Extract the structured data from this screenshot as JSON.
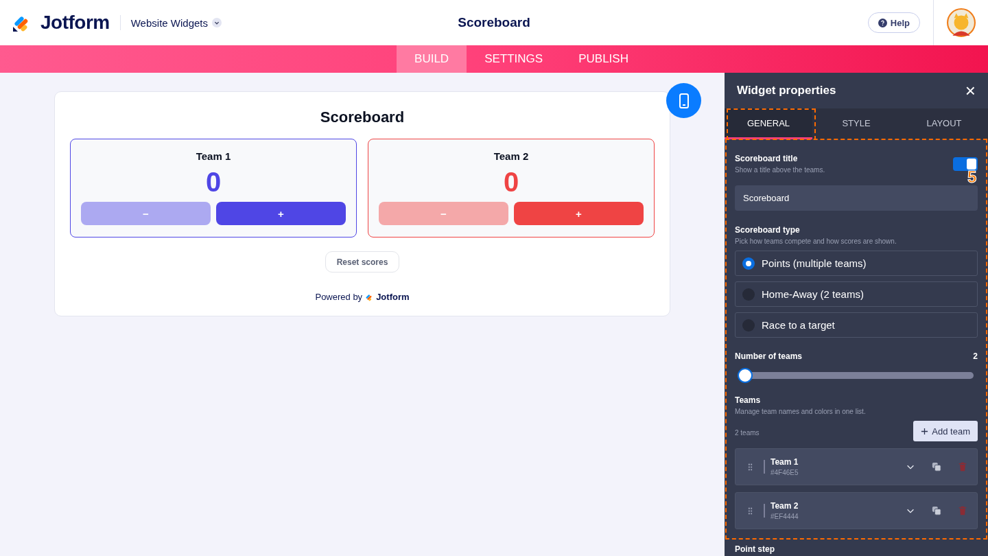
{
  "header": {
    "brand": "Jotform",
    "product": "Website Widgets",
    "title": "Scoreboard",
    "help": "Help"
  },
  "nav_tabs": [
    {
      "label": "BUILD",
      "selected": true
    },
    {
      "label": "SETTINGS",
      "selected": false
    },
    {
      "label": "PUBLISH",
      "selected": false
    }
  ],
  "scoreboard": {
    "title": "Scoreboard",
    "teams": [
      {
        "name": "Team 1",
        "score": "0",
        "color": "#4f46e5",
        "minus": "−",
        "plus": "+"
      },
      {
        "name": "Team 2",
        "score": "0",
        "color": "#ef4444",
        "minus": "−",
        "plus": "+"
      }
    ],
    "reset": "Reset scores",
    "powered_by": "Powered by",
    "powered_brand": "Jotform"
  },
  "panel": {
    "title": "Widget properties",
    "close": "×",
    "tabs": [
      {
        "label": "GENERAL",
        "selected": true
      },
      {
        "label": "STYLE",
        "selected": false
      },
      {
        "label": "LAYOUT",
        "selected": false
      }
    ],
    "title_setting": {
      "label": "Scoreboard title",
      "hint": "Show a title above the teams.",
      "on": true,
      "value": "Scoreboard"
    },
    "type_setting": {
      "label": "Scoreboard type",
      "hint": "Pick how teams compete and how scores are shown.",
      "options": [
        {
          "label": "Points (multiple teams)",
          "selected": true
        },
        {
          "label": "Home-Away (2 teams)",
          "selected": false
        },
        {
          "label": "Race to a target",
          "selected": false
        }
      ]
    },
    "team_count": {
      "label": "Number of teams",
      "reading": "2",
      "level": 0
    },
    "teams": {
      "label": "Teams",
      "hint": "Manage team names and colors in one list.",
      "count": "2 teams",
      "add": "Add team",
      "items": [
        {
          "name": "Team 1",
          "hex": "#4F46E5"
        },
        {
          "name": "Team 2",
          "hex": "#EF4444"
        }
      ]
    },
    "next_label": "Point step"
  },
  "annotation": {
    "step": "5"
  }
}
